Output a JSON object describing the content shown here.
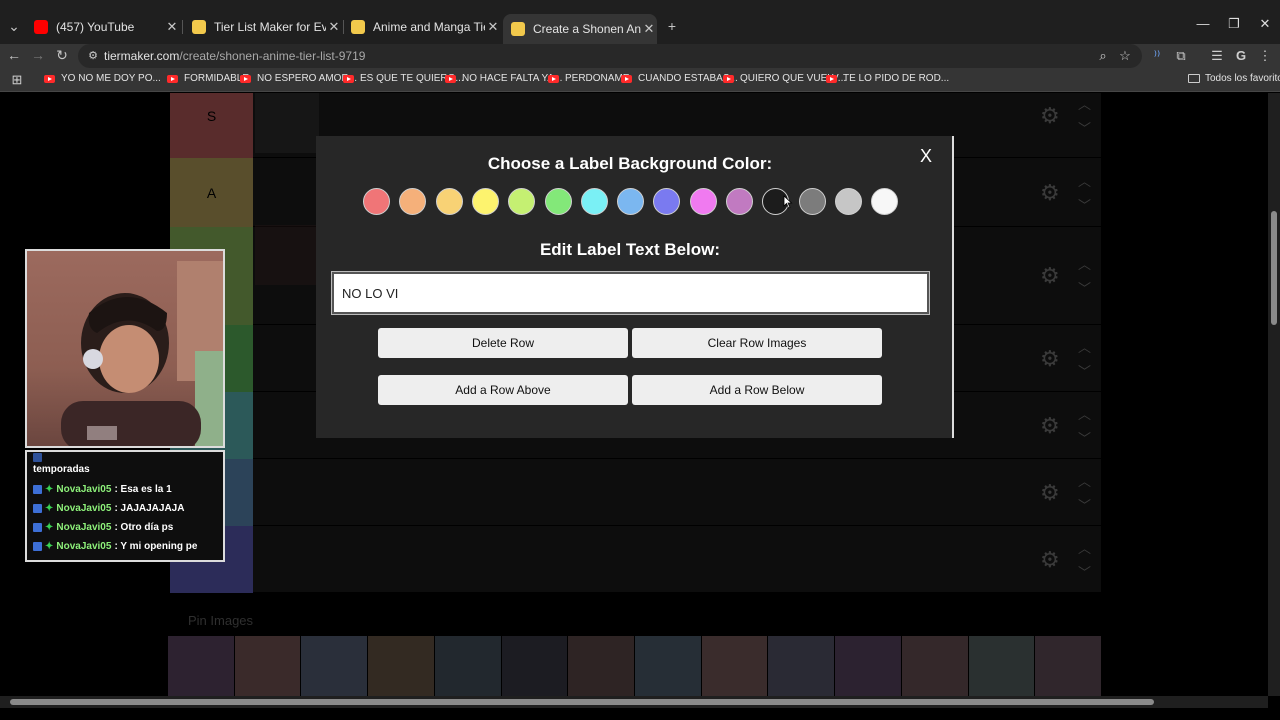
{
  "browser": {
    "tabs": [
      {
        "title": "(457) YouTube",
        "favicon_color": "#ff0000"
      },
      {
        "title": "Tier List Maker for Everything -",
        "favicon_color": "#f2c94c"
      },
      {
        "title": "Anime and Manga Tier List Tem",
        "favicon_color": "#f2c94c"
      },
      {
        "title": "Create a Shonen Anime Tier List",
        "favicon_color": "#f2c94c"
      }
    ],
    "url_host": "tiermaker.com",
    "url_path": "/create/shonen-anime-tier-list-9719",
    "bookmarks": [
      "YO NO ME DOY PO...",
      "FORMIDABLE",
      "NO ESPERO AMOR...",
      "ES QUE TE QUIERO...",
      "NO HACE FALTA YA...",
      "PERDONAME",
      "CUANDO ESTABAS...",
      "QUIERO QUE VUELV...",
      "TE LO PIDO DE ROD..."
    ],
    "all_bookmarks_label": "Todos los favoritos"
  },
  "modal": {
    "title": "Choose a Label Background Color:",
    "close_label": "X",
    "swatches": [
      "#f07577",
      "#f5b07a",
      "#f8d275",
      "#fdf36e",
      "#c5f072",
      "#83e879",
      "#7af0f5",
      "#7bb7f0",
      "#7a7af0",
      "#f07af0",
      "#c17ac1",
      "#1c1c1c",
      "#7c7c7c",
      "#c6c6c6",
      "#f7f7f7"
    ],
    "edit_title": "Edit Label Text Below:",
    "label_text": "NO LO VI",
    "buttons": {
      "delete": "Delete Row",
      "clear": "Clear Row Images",
      "add_above": "Add a Row Above",
      "add_below": "Add a Row Below"
    }
  },
  "background": {
    "pin_label": "Pin Images",
    "tiers": [
      {
        "label": "S",
        "color": "#ff7f7f"
      },
      {
        "label": "A",
        "color": "#ffdf7f"
      },
      {
        "label": "",
        "color": "#bfff7f"
      },
      {
        "label": "",
        "color": "#7fff7f"
      },
      {
        "label": "",
        "color": "#7fffff"
      },
      {
        "label": "",
        "color": "#7fbfff"
      },
      {
        "label": "",
        "color": "#7f7fff"
      }
    ]
  },
  "chat": {
    "partial_top": "temporadas",
    "messages": [
      {
        "user": "NovaJavi05",
        "text": ": Esa es la 1"
      },
      {
        "user": "NovaJavi05",
        "text": ": JAJAJAJAJA"
      },
      {
        "user": "NovaJavi05",
        "text": ": Otro día ps"
      },
      {
        "user": "NovaJavi05",
        "text": ": Y mi opening pe"
      }
    ]
  }
}
